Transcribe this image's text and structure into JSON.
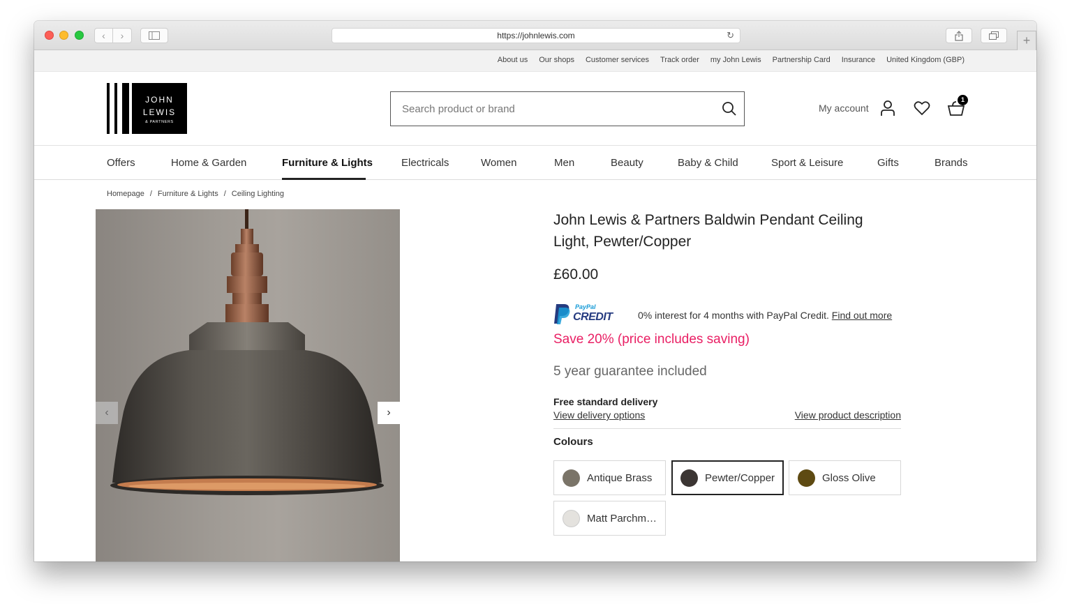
{
  "browser": {
    "url": "https://johnlewis.com",
    "back_glyph": "‹",
    "forward_glyph": "›",
    "plus_glyph": "+"
  },
  "utility_links": [
    "About us",
    "Our shops",
    "Customer services",
    "Track order",
    "my John Lewis",
    "Partnership Card",
    "Insurance",
    "United Kingdom (GBP)"
  ],
  "logo": {
    "line1": "JOHN",
    "line2": "LEWIS",
    "line3": "& PARTNERS"
  },
  "search": {
    "placeholder": "Search product or brand"
  },
  "account": {
    "label": "My account",
    "basket_count": "1"
  },
  "nav": {
    "items": [
      "Offers",
      "Home & Garden",
      "Furniture & Lights",
      "Electricals",
      "Women",
      "Men",
      "Beauty",
      "Baby & Child",
      "Sport & Leisure",
      "Gifts",
      "Brands"
    ],
    "active": "Furniture & Lights"
  },
  "breadcrumb": {
    "items": [
      "Homepage",
      "Furniture & Lights",
      "Ceiling Lighting"
    ],
    "separator": "/"
  },
  "carousel": {
    "prev_glyph": "‹",
    "next_glyph": "›"
  },
  "product": {
    "title": "John Lewis & Partners Baldwin Pendant Ceiling Light, Pewter/Copper",
    "price": "£60.00",
    "paypal_brand_top": "PayPal",
    "paypal_brand_bottom": "CREDIT",
    "paypal_text": "0% interest for 4 months with PayPal Credit.",
    "paypal_link": "Find out more",
    "save_text": "Save 20% (price includes saving)",
    "guarantee": "5 year guarantee included",
    "delivery_title": "Free standard delivery",
    "delivery_link": "View delivery options",
    "description_link": "View product description",
    "colours_title": "Colours",
    "colours": [
      {
        "label": "Antique Brass",
        "color": "#7a7468",
        "selected": false
      },
      {
        "label": "Pewter/Copper",
        "color": "#3b3533",
        "selected": true
      },
      {
        "label": "Gloss Olive",
        "color": "#5e4a12",
        "selected": false
      },
      {
        "label": "Matt Parchm…",
        "color": "#e4e2de",
        "selected": false
      }
    ]
  },
  "colors": {
    "save_pink": "#e91e63",
    "paypal_dark": "#253b80",
    "paypal_light": "#179bd7"
  }
}
